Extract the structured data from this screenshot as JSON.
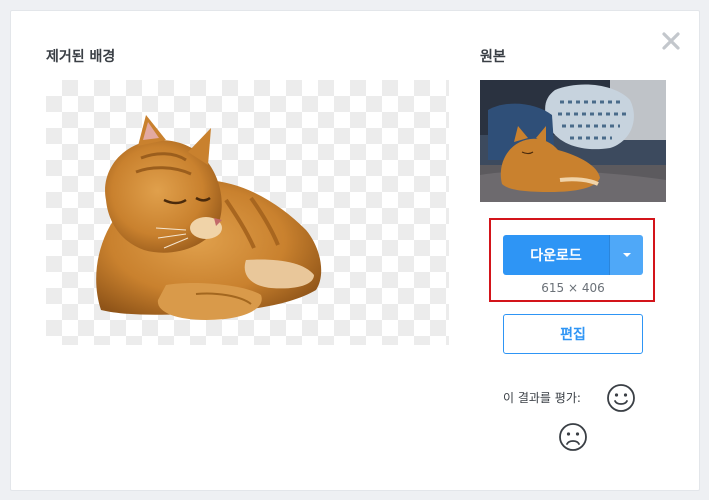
{
  "dialog": {
    "removed_background_title": "제거된 배경",
    "original_title": "원본"
  },
  "download": {
    "button_label": "다운로드",
    "dimensions": "615 × 406"
  },
  "edit": {
    "button_label": "편집"
  },
  "rating": {
    "prompt": "이 결과를 평가:"
  },
  "icons": {
    "close": "close-icon",
    "dropdown": "chevron-down-icon",
    "rate_good": "smiley-happy-icon",
    "rate_bad": "smiley-sad-icon"
  },
  "colors": {
    "accent": "#2e95f5",
    "highlight_border": "#d3141a"
  }
}
